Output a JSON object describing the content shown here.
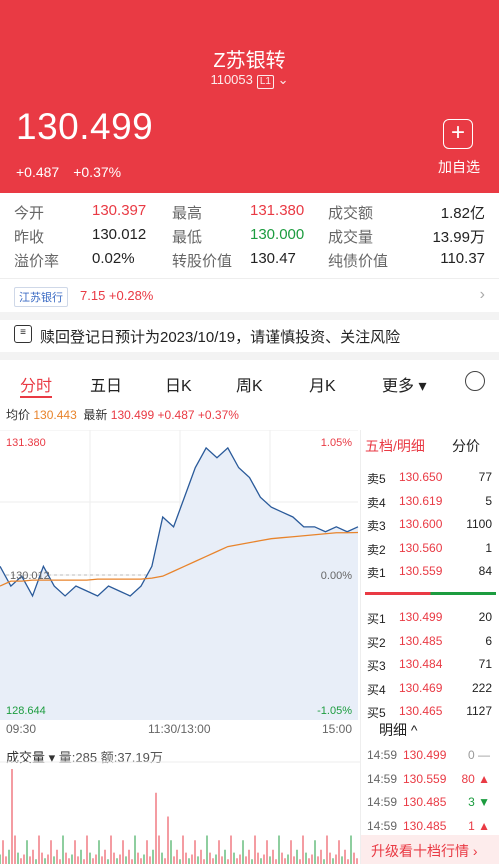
{
  "header": {
    "title": "Z苏银转",
    "code": "110053",
    "level": "L1",
    "price": "130.499",
    "change": "+0.487",
    "change_pct": "+0.37%",
    "add_label": "加自选",
    "add_icon": "plus-icon"
  },
  "stats": [
    [
      {
        "k": "今开",
        "v": "130.397",
        "c": "red"
      },
      {
        "k": "最高",
        "v": "131.380",
        "c": "red"
      },
      {
        "k": "成交额",
        "v": "1.82亿",
        "c": ""
      }
    ],
    [
      {
        "k": "昨收",
        "v": "130.012",
        "c": ""
      },
      {
        "k": "最低",
        "v": "130.000",
        "c": "grn"
      },
      {
        "k": "成交量",
        "v": "13.99万",
        "c": ""
      }
    ],
    [
      {
        "k": "溢价率",
        "v": "0.02%",
        "c": ""
      },
      {
        "k": "转股价值",
        "v": "130.47",
        "c": ""
      },
      {
        "k": "纯债价值",
        "v": "110.37",
        "c": ""
      }
    ]
  ],
  "related": {
    "name": "江苏银行",
    "value": "7.15 +0.28%"
  },
  "notice": "赎回登记日预计为2023/10/19，请谨慎投资、关注风险",
  "tabs": [
    "分时",
    "五日",
    "日K",
    "周K",
    "月K",
    "更多"
  ],
  "legend": {
    "avg_label": "均价",
    "avg": "130.443",
    "last_label": "最新",
    "last": "130.499",
    "chg": "+0.487",
    "pct": "+0.37%"
  },
  "chart_data": {
    "type": "line",
    "y_top": "131.380",
    "y_bottom": "128.644",
    "y_mid": "130.012",
    "pct_top": "1.05%",
    "pct_mid": "0.00%",
    "pct_bottom": "-1.05%",
    "x_labels": [
      "09:30",
      "11:30/13:00",
      "15:00"
    ],
    "ylim": [
      128.644,
      131.38
    ],
    "series": [
      {
        "values": [
          130.1,
          129.9,
          130.0,
          129.8,
          130.1,
          129.9,
          129.8,
          129.9,
          129.85,
          129.8,
          129.9,
          129.85,
          129.8,
          129.9,
          130.1,
          130.6,
          130.5,
          130.8,
          131.1,
          131.3,
          131.2,
          131.3,
          131.1,
          131.0,
          130.8,
          130.7,
          130.65,
          130.6,
          130.5,
          130.5,
          130.45,
          130.5,
          130.45,
          130.5
        ]
      },
      {
        "values": [
          129.9,
          129.95,
          129.95,
          129.96,
          129.96,
          129.96,
          129.96,
          129.96,
          129.96,
          129.97,
          129.97,
          129.97,
          129.97,
          129.97,
          129.98,
          130.0,
          130.05,
          130.1,
          130.15,
          130.2,
          130.25,
          130.3,
          130.32,
          130.34,
          130.36,
          130.38,
          130.39,
          130.4,
          130.41,
          130.42,
          130.43,
          130.44,
          130.44,
          130.443
        ]
      }
    ]
  },
  "orderbook": {
    "title": "五档/明细",
    "tab2": "分价",
    "asks": [
      [
        "卖5",
        "130.650",
        "77"
      ],
      [
        "卖4",
        "130.619",
        "5"
      ],
      [
        "卖3",
        "130.600",
        "1100"
      ],
      [
        "卖2",
        "130.560",
        "1"
      ],
      [
        "卖1",
        "130.559",
        "84"
      ]
    ],
    "bids": [
      [
        "买1",
        "130.499",
        "20"
      ],
      [
        "买2",
        "130.485",
        "6"
      ],
      [
        "买3",
        "130.484",
        "71"
      ],
      [
        "买4",
        "130.469",
        "222"
      ],
      [
        "买5",
        "130.465",
        "1127"
      ]
    ],
    "detail_label": "明细",
    "trades": [
      [
        "14:59",
        "130.499",
        "0",
        "#999"
      ],
      [
        "14:59",
        "130.559",
        "80",
        "#e93a44"
      ],
      [
        "14:59",
        "130.485",
        "3",
        "#1c9c3f"
      ],
      [
        "14:59",
        "130.485",
        "1",
        "#e93a44"
      ]
    ],
    "upgrade": "升级看十档行情"
  },
  "volume": {
    "label": "成交量",
    "qty_label": "量:285",
    "amt_label": "额:37.19万"
  }
}
